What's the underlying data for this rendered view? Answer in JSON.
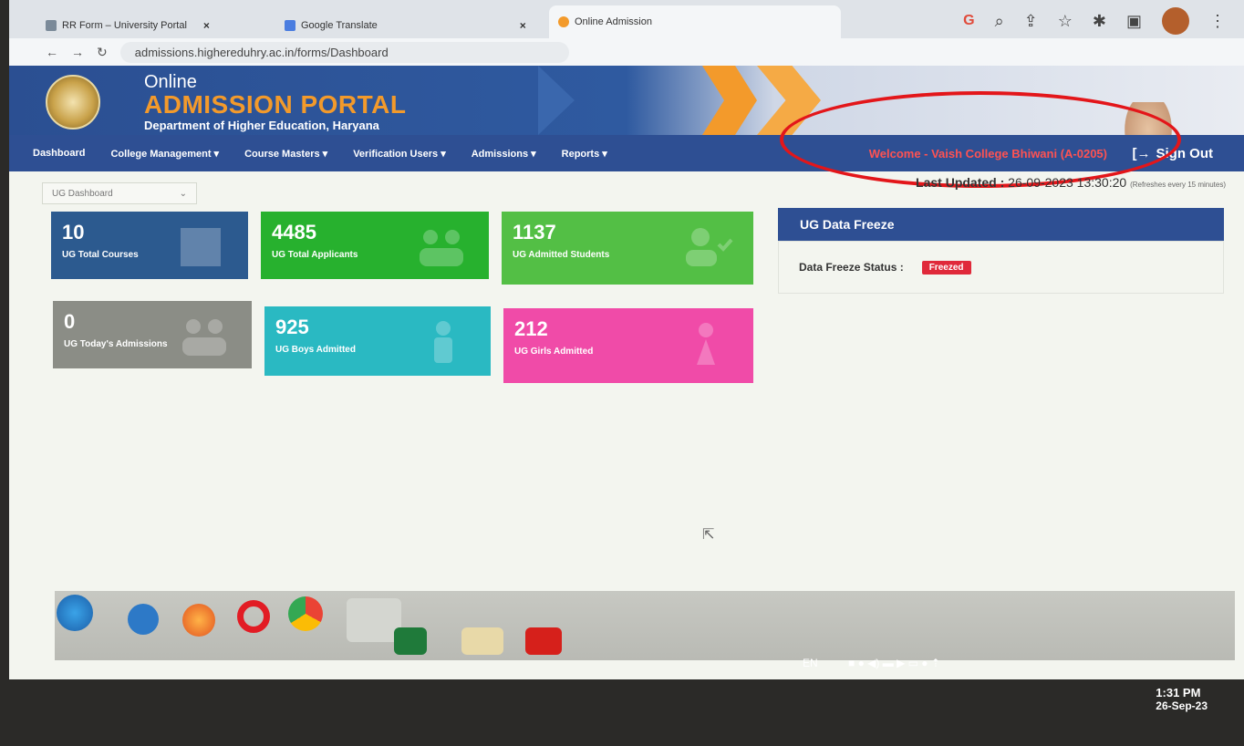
{
  "browser": {
    "tabs": [
      {
        "label": "RR Form – University Portal",
        "close": "×"
      },
      {
        "label": "Google Translate",
        "close": "×"
      },
      {
        "label": "Online Admission",
        "close": ""
      }
    ],
    "url": "admissions.highereduhry.ac.in/forms/Dashboard",
    "icons": [
      "google-icon",
      "search-icon",
      "share-icon",
      "star-icon",
      "extensions-icon",
      "sidebar-icon",
      "profile-avatar",
      "menu-icon"
    ]
  },
  "header": {
    "line1": "Online",
    "line2": "ADMISSION PORTAL",
    "line3": "Department of Higher Education, Haryana"
  },
  "nav": {
    "items": [
      "Dashboard",
      "College Management ▾",
      "Course Masters ▾",
      "Verification Users ▾",
      "Admissions ▾",
      "Reports ▾"
    ],
    "welcome": "Welcome - Vaish College Bhiwani (A-0205)",
    "signout": "Sign Out",
    "signout_icon": "[→"
  },
  "dashboard": {
    "select_value": "UG Dashboard",
    "last_updated_label": "Last Updated :",
    "last_updated_value": "26-09-2023 13:30:20",
    "refresh_note": "(Refreshes every 15 minutes)"
  },
  "cards": [
    {
      "value": "10",
      "label": "UG Total Courses",
      "color": "#2c5a8f"
    },
    {
      "value": "4485",
      "label": "UG Total Applicants",
      "color": "#27b12e"
    },
    {
      "value": "1137",
      "label": "UG Admitted Students",
      "color": "#53bf45"
    },
    {
      "value": "0",
      "label": "UG Today's Admissions",
      "color": "#8b8d86"
    },
    {
      "value": "925",
      "label": "UG Boys Admitted",
      "color": "#2ab9c2"
    },
    {
      "value": "212",
      "label": "UG Girls Admitted",
      "color": "#f04ba8"
    }
  ],
  "freeze": {
    "title": "UG Data Freeze",
    "status_label": "Data Freeze Status :",
    "status_value": "Freezed",
    "status_color": "#e0293a"
  },
  "taskbar": {
    "language": "EN",
    "time": "1:31 PM",
    "date": "26-Sep-23"
  }
}
